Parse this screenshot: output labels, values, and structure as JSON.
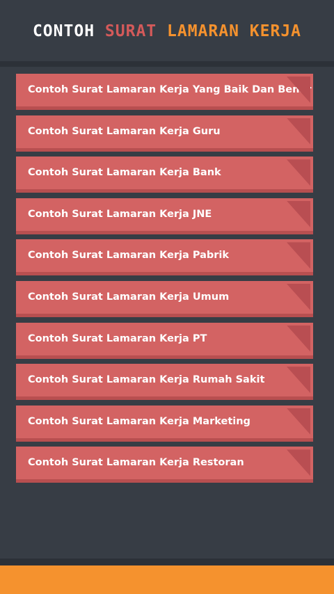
{
  "header": {
    "title_part1": "CONTOH",
    "title_part2": "SURAT",
    "title_part3": "LAMARAN KERJA"
  },
  "items": [
    {
      "label": "Contoh Surat Lamaran Kerja Yang Baik Dan Benar"
    },
    {
      "label": "Contoh Surat Lamaran Kerja Guru"
    },
    {
      "label": "Contoh Surat Lamaran Kerja Bank"
    },
    {
      "label": "Contoh Surat Lamaran Kerja JNE"
    },
    {
      "label": "Contoh Surat Lamaran Kerja Pabrik"
    },
    {
      "label": "Contoh Surat Lamaran Kerja Umum"
    },
    {
      "label": "Contoh Surat Lamaran Kerja PT"
    },
    {
      "label": "Contoh Surat Lamaran Kerja Rumah Sakit"
    },
    {
      "label": "Contoh Surat Lamaran Kerja Marketing"
    },
    {
      "label": "Contoh Surat Lamaran Kerja Restoran"
    }
  ],
  "colors": {
    "background": "#373d45",
    "item": "#d36363",
    "item_shadow": "#b84f50",
    "accent_orange": "#f5922e",
    "accent_red": "#d45a5a"
  }
}
